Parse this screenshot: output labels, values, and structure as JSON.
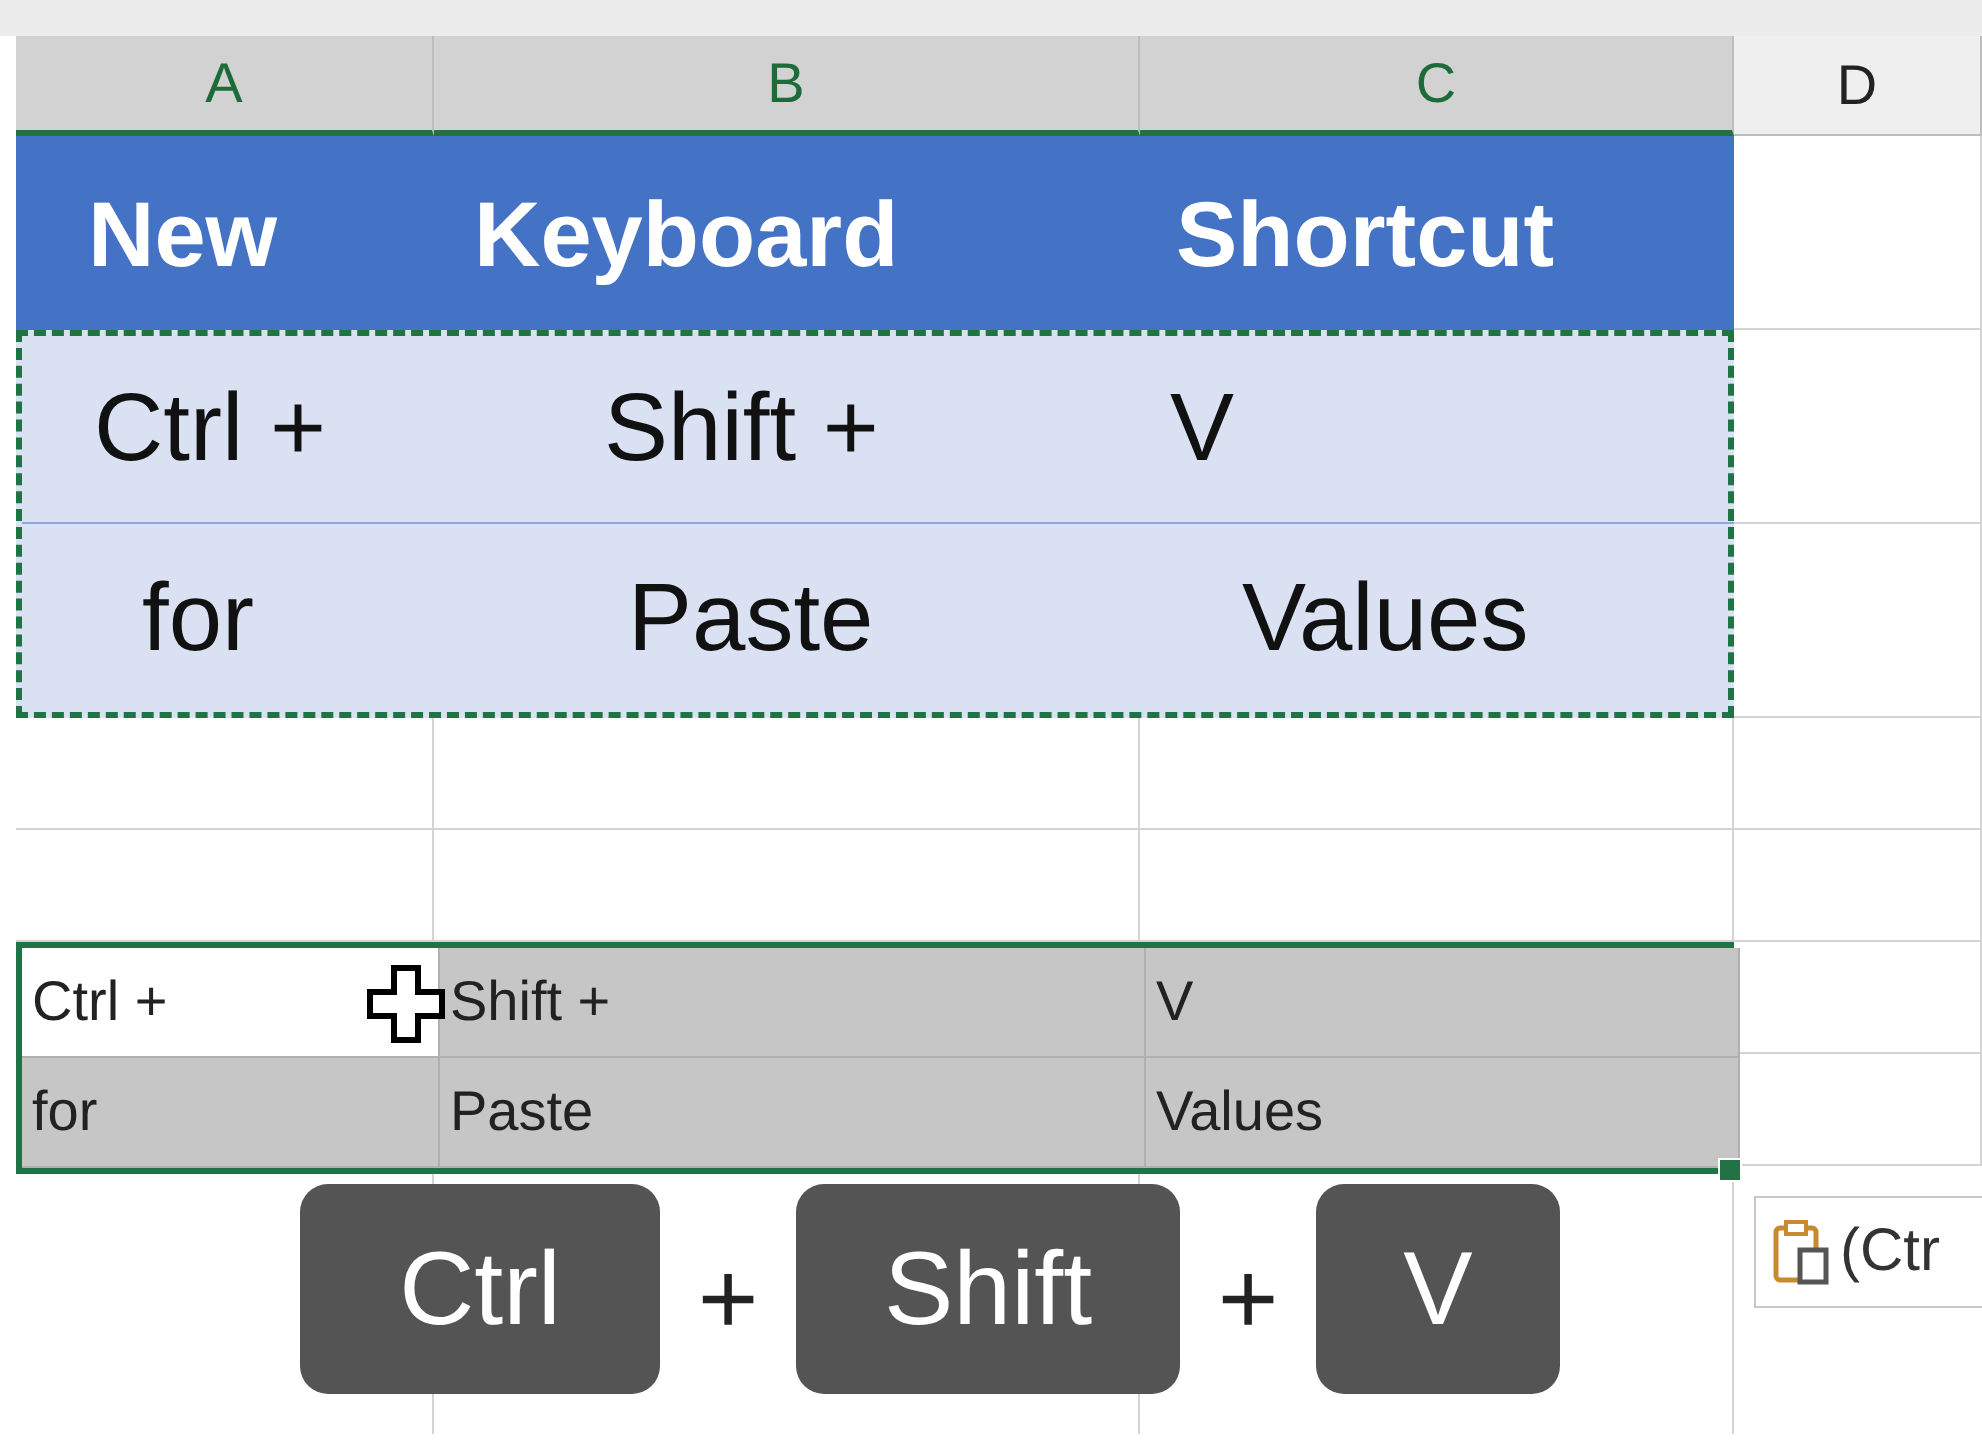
{
  "column_headers": [
    {
      "label": "A",
      "selected": true
    },
    {
      "label": "B",
      "selected": true
    },
    {
      "label": "C",
      "selected": true
    },
    {
      "label": "D",
      "selected": false
    }
  ],
  "title_row": [
    "New",
    "Keyboard",
    "Shortcut"
  ],
  "copied_rows": [
    [
      "Ctrl +",
      "Shift +",
      "V"
    ],
    [
      "for",
      "Paste",
      "Values"
    ]
  ],
  "pasted_rows": [
    [
      {
        "text": "Ctrl +",
        "active": true
      },
      {
        "text": "Shift +",
        "active": false
      },
      {
        "text": "V",
        "active": false
      }
    ],
    [
      {
        "text": "for",
        "active": false
      },
      {
        "text": "Paste",
        "active": false
      },
      {
        "text": "Values",
        "active": false
      }
    ]
  ],
  "paste_options": {
    "label": "(Ctr"
  },
  "shortcut": {
    "keys": [
      "Ctrl",
      "Shift",
      "V"
    ],
    "separators": [
      "+",
      "+"
    ]
  }
}
